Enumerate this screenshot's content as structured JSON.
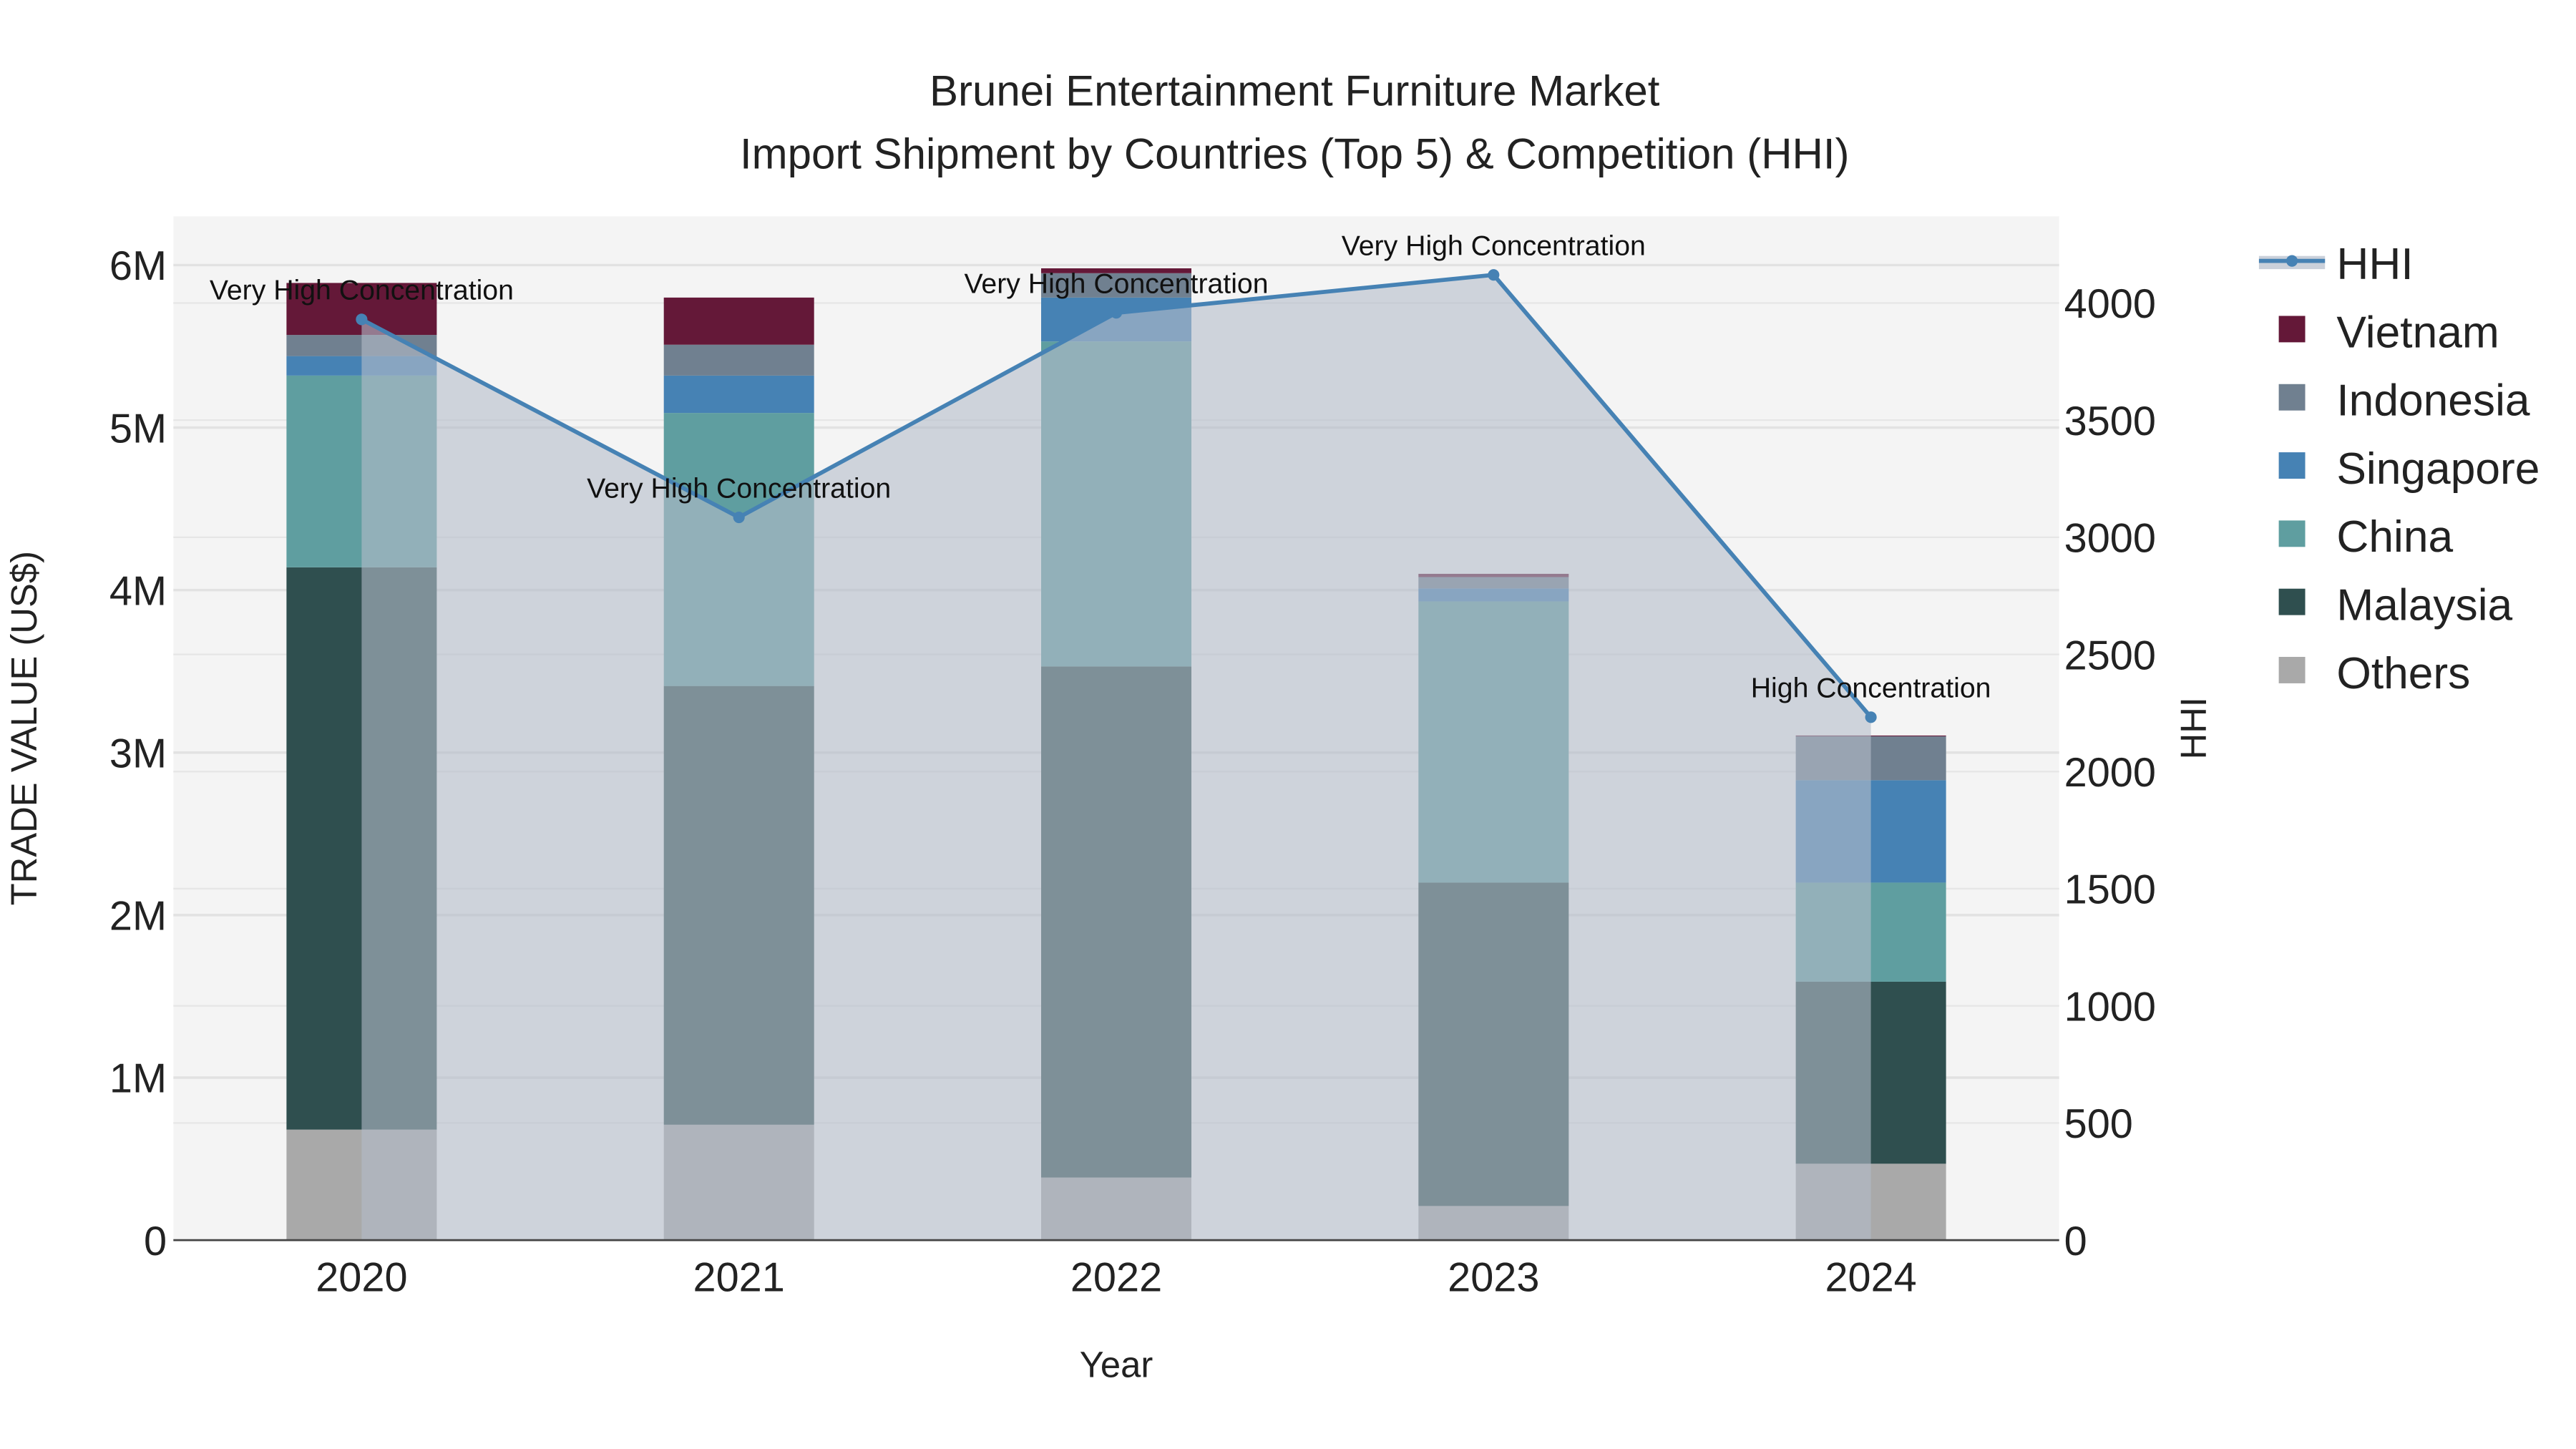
{
  "chart_data": {
    "type": "bar",
    "title": "Brunei Entertainment Furniture Market",
    "subtitle": "Import Shipment by Countries (Top 5) & Competition (HHI)",
    "xlabel": "Year",
    "ylabel": "TRADE VALUE (US$)",
    "y2label": "HHI",
    "categories": [
      "2020",
      "2021",
      "2022",
      "2023",
      "2024"
    ],
    "ylim": [
      0,
      6300000
    ],
    "y2lim": [
      0,
      4370
    ],
    "yticks": [
      {
        "v": 0,
        "label": "0"
      },
      {
        "v": 1000000,
        "label": "1M"
      },
      {
        "v": 2000000,
        "label": "2M"
      },
      {
        "v": 3000000,
        "label": "3M"
      },
      {
        "v": 4000000,
        "label": "4M"
      },
      {
        "v": 5000000,
        "label": "5M"
      },
      {
        "v": 6000000,
        "label": "6M"
      }
    ],
    "y2ticks": [
      0,
      500,
      1000,
      1500,
      2000,
      2500,
      3000,
      3500,
      4000
    ],
    "series": [
      {
        "name": "Others",
        "color": "#a9a9a9",
        "values": [
          680000,
          710000,
          385000,
          210000,
          470000
        ]
      },
      {
        "name": "Malaysia",
        "color": "#2f4f4f",
        "values": [
          3460000,
          2700000,
          3145000,
          1990000,
          1120000
        ]
      },
      {
        "name": "China",
        "color": "#5f9ea0",
        "values": [
          1180000,
          1680000,
          2000000,
          1730000,
          610000
        ]
      },
      {
        "name": "Singapore",
        "color": "#4682b4",
        "values": [
          120000,
          230000,
          270000,
          80000,
          630000
        ]
      },
      {
        "name": "Indonesia",
        "color": "#708090",
        "values": [
          130000,
          190000,
          150000,
          70000,
          270000
        ]
      },
      {
        "name": "Vietnam",
        "color": "#641838",
        "values": [
          320000,
          290000,
          30000,
          20000,
          5000
        ]
      }
    ],
    "hhi": {
      "name": "HHI",
      "color": "#4682b4",
      "values": [
        3930,
        3085,
        3958,
        4120,
        2232
      ],
      "annotations": [
        "Very High Concentration",
        "Very High Concentration",
        "Very High Concentration",
        "Very High Concentration",
        "High Concentration"
      ]
    },
    "legend": [
      "HHI",
      "Vietnam",
      "Indonesia",
      "Singapore",
      "China",
      "Malaysia",
      "Others"
    ],
    "legend_position": "right",
    "grid": true
  }
}
